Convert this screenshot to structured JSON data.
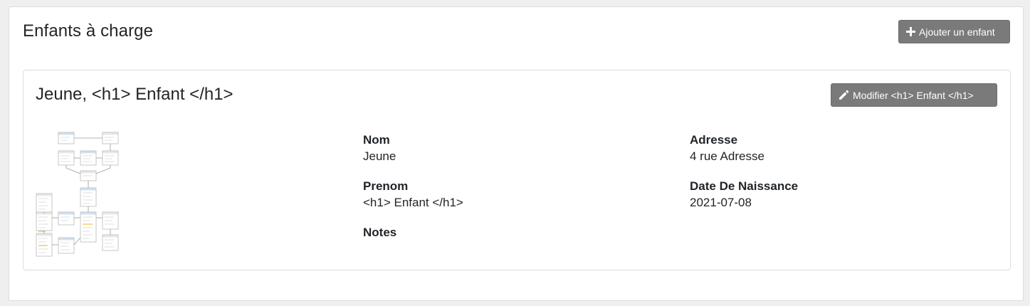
{
  "section": {
    "title": "Enfants à charge",
    "add_button_label": "Ajouter un enfant"
  },
  "child": {
    "title": "Jeune, <h1> Enfant </h1>",
    "edit_button_label": "Modifier <h1> Enfant </h1>",
    "thumbnail_icon": "diagram-thumbnail",
    "fields": {
      "nom": {
        "label": "Nom",
        "value": "Jeune"
      },
      "prenom": {
        "label": "Prenom",
        "value": "<h1> Enfant </h1>"
      },
      "notes": {
        "label": "Notes",
        "value": ""
      },
      "adresse": {
        "label": "Adresse",
        "value": "4 rue Adresse"
      },
      "date_naissance": {
        "label": "Date De Naissance",
        "value": "2021-07-08"
      }
    }
  },
  "colors": {
    "button_bg": "#7a7a7a",
    "page_bg": "#efefef",
    "card_border": "#dcdcdc"
  }
}
